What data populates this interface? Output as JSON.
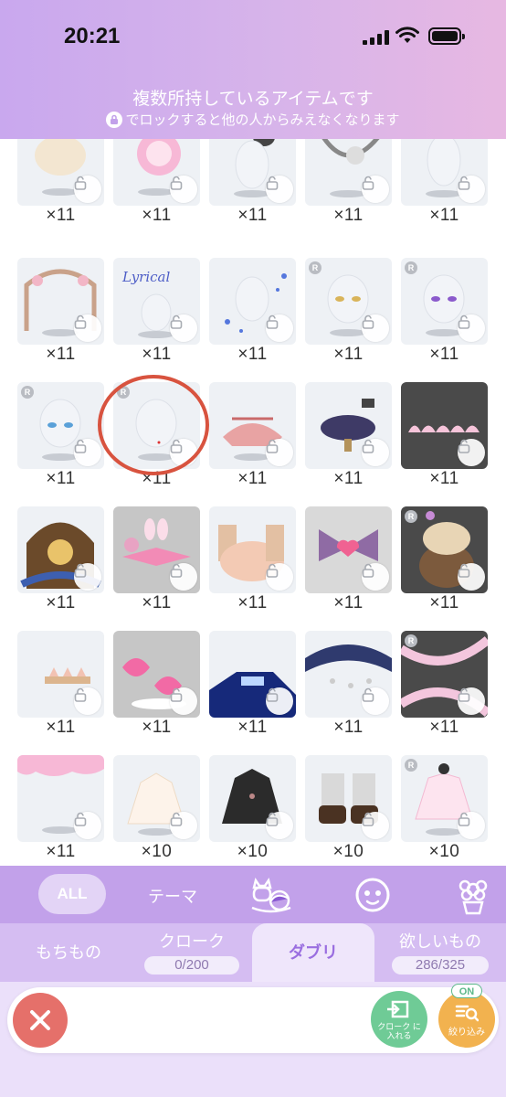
{
  "status_bar": {
    "time": "20:21"
  },
  "header": {
    "title": "複数所持しているアイテムです",
    "subtitle": "でロックすると他の人からみえなくなります"
  },
  "grid": {
    "items": [
      {
        "count": "×11",
        "bg": "light",
        "badge": ""
      },
      {
        "count": "×11",
        "bg": "light",
        "badge": ""
      },
      {
        "count": "×11",
        "bg": "light",
        "badge": "tool"
      },
      {
        "count": "×11",
        "bg": "light",
        "badge": "tool"
      },
      {
        "count": "×11",
        "bg": "light",
        "badge": ""
      },
      {
        "count": "×11",
        "bg": "light",
        "badge": ""
      },
      {
        "count": "×11",
        "bg": "light",
        "badge": "",
        "text": "Lyrical"
      },
      {
        "count": "×11",
        "bg": "light",
        "badge": ""
      },
      {
        "count": "×11",
        "bg": "light",
        "badge": "R"
      },
      {
        "count": "×11",
        "bg": "light",
        "badge": "R"
      },
      {
        "count": "×11",
        "bg": "light",
        "badge": "R"
      },
      {
        "count": "×11",
        "bg": "light",
        "badge": "R"
      },
      {
        "count": "×11",
        "bg": "light",
        "badge": ""
      },
      {
        "count": "×11",
        "bg": "light",
        "badge": ""
      },
      {
        "count": "×11",
        "bg": "dark",
        "badge": ""
      },
      {
        "count": "×11",
        "bg": "light",
        "badge": ""
      },
      {
        "count": "×11",
        "bg": "gray",
        "badge": ""
      },
      {
        "count": "×11",
        "bg": "light",
        "badge": ""
      },
      {
        "count": "×11",
        "bg": "lgray",
        "badge": ""
      },
      {
        "count": "×11",
        "bg": "dark",
        "badge": "R"
      },
      {
        "count": "×11",
        "bg": "light",
        "badge": ""
      },
      {
        "count": "×11",
        "bg": "gray",
        "badge": ""
      },
      {
        "count": "×11",
        "bg": "light",
        "badge": ""
      },
      {
        "count": "×11",
        "bg": "light",
        "badge": ""
      },
      {
        "count": "×11",
        "bg": "dark",
        "badge": "R"
      },
      {
        "count": "×11",
        "bg": "light",
        "badge": ""
      },
      {
        "count": "×10",
        "bg": "light",
        "badge": ""
      },
      {
        "count": "×10",
        "bg": "light",
        "badge": ""
      },
      {
        "count": "×10",
        "bg": "light",
        "badge": ""
      },
      {
        "count": "×10",
        "bg": "light",
        "badge": "R"
      }
    ]
  },
  "categories": {
    "all": "ALL",
    "theme": "テーマ"
  },
  "tabs": {
    "mochimono": "もちもの",
    "cloak": "クローク",
    "cloak_count": "0/200",
    "daburi": "ダブリ",
    "wishlist": "欲しいもの",
    "wishlist_count": "286/325"
  },
  "actions": {
    "closet_label_1": "クローク に",
    "closet_label_2": "入れる",
    "filter_on": "ON",
    "filter_label": "絞り込み"
  },
  "colors": {
    "accent": "#c2a1ea",
    "highlight_circle": "#d8533f",
    "close_button": "#e5706a",
    "closet_button": "#6fcb96",
    "filter_button": "#f2b24f"
  }
}
